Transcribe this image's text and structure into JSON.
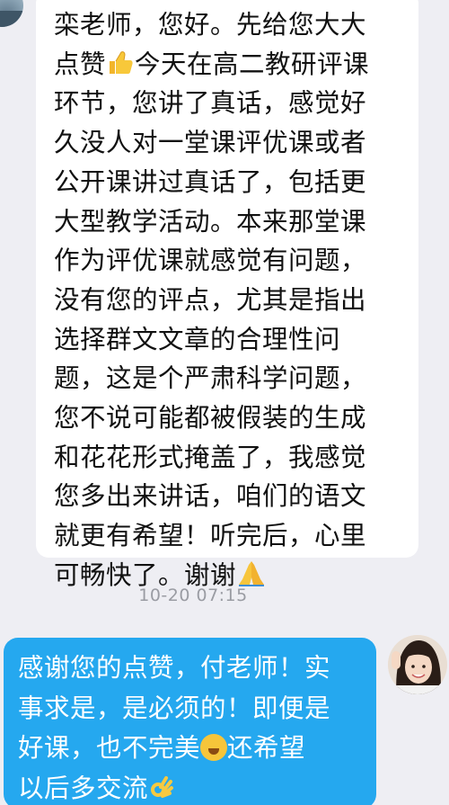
{
  "incoming_message": {
    "lines": [
      "栾老师，您好。先给您大大",
      "点赞",
      "今天在高二教研评课",
      "环节，您讲了真话，感觉好",
      "久没人对一堂课评优课或者",
      "公开课讲过真话了，包括更",
      "大型教学活动。本来那堂课",
      "作为评优课就感觉有问题，",
      "没有您的评点，尤其是指出",
      "选择群文文章的合理性问",
      "题，这是个严肃科学问题，",
      "您不说可能都被假装的生成",
      "和花花形式掩盖了，我感觉",
      "您多出来讲话，咱们的语文",
      "就更有希望！听完后，心里",
      "可畅快了。谢谢"
    ],
    "emoji_thumbs": "👍",
    "emoji_pray": "🙏"
  },
  "timestamp": "10-20 07:15",
  "outgoing_message": {
    "lines": [
      "感谢您的点赞，付老师！实",
      "事求是，是必须的！即便是",
      "好课，也不完美",
      "还希望",
      "以后多交流"
    ],
    "emoji_giggle": "🤭",
    "emoji_ok": "👌"
  },
  "colors": {
    "background": "#eeeef3",
    "incoming_bubble": "#ffffff",
    "outgoing_bubble": "#25a8ef",
    "timestamp_text": "#9a9ca3"
  }
}
